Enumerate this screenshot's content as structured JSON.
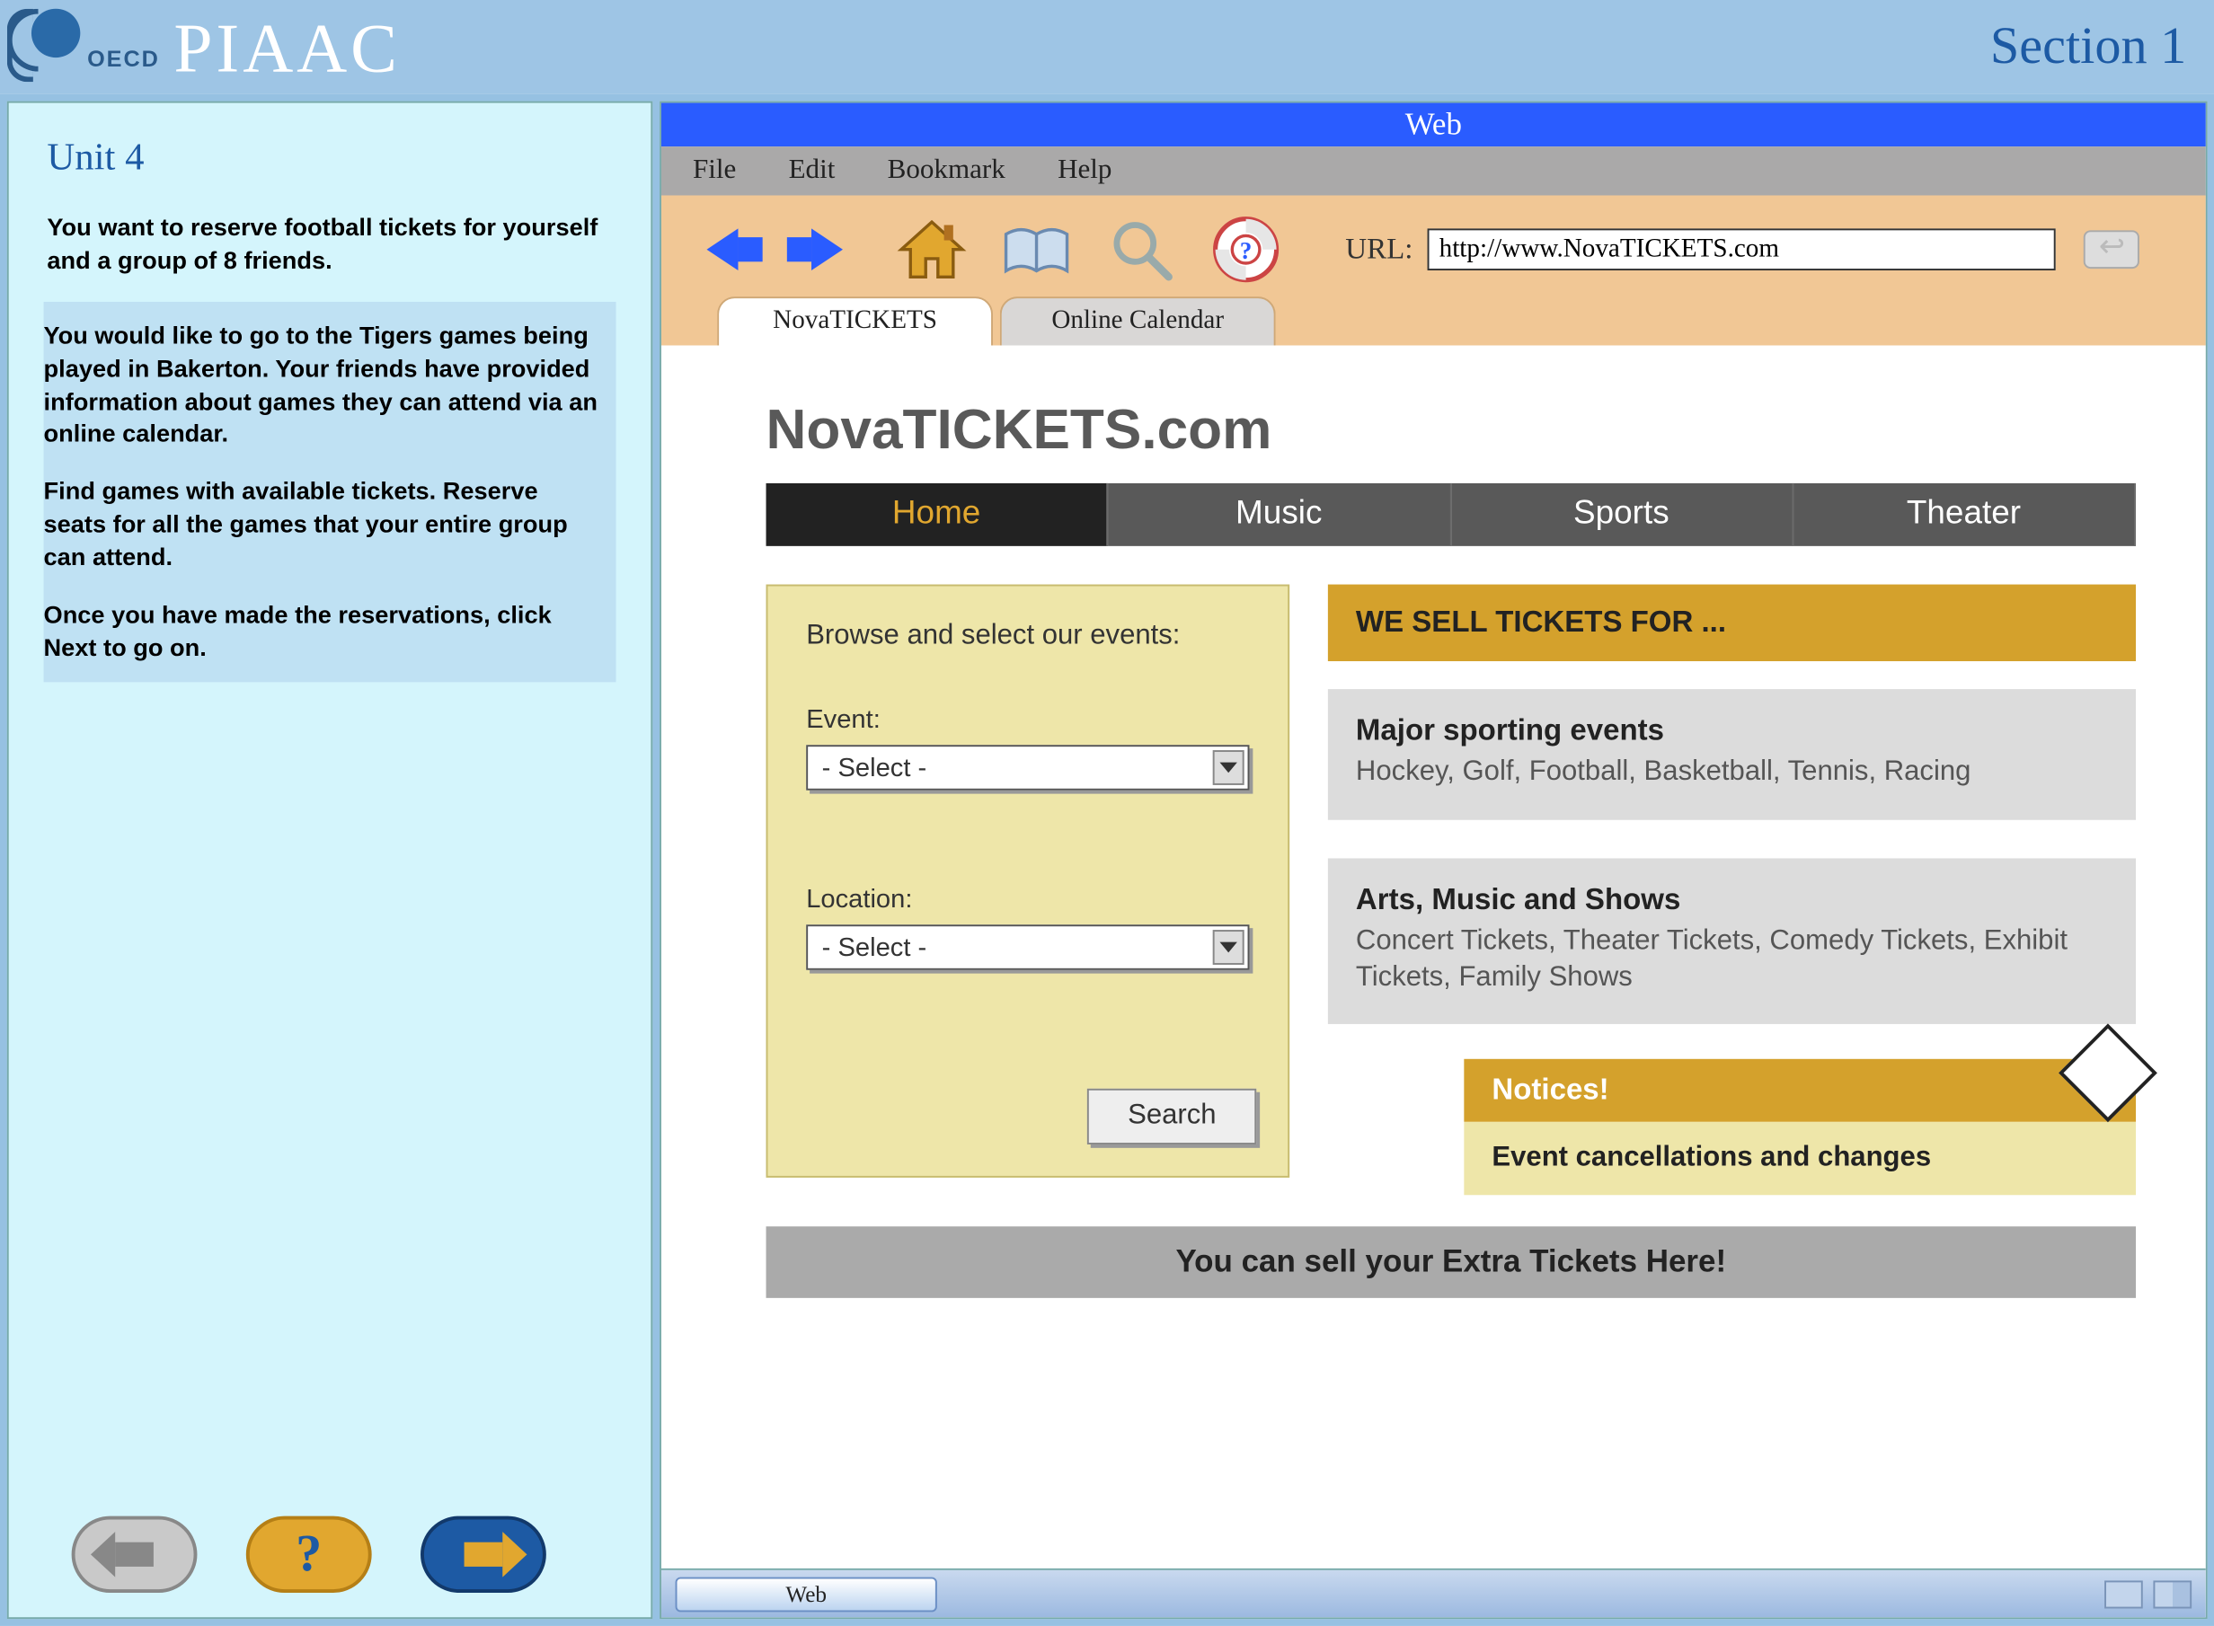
{
  "header": {
    "oecd": "OECD",
    "piaac": "PIAAC",
    "section": "Section 1"
  },
  "left": {
    "unit": "Unit 4",
    "intro": "You want to reserve football tickets for yourself and a group of 8 friends.",
    "p1": "You would like to go to the Tigers games being played in Bakerton. Your friends have provided information about games they can attend via an online calendar.",
    "p2": "Find games with available tickets. Reserve seats for all the games that your entire group can attend.",
    "p3": "Once you have made the reservations, click Next to go on."
  },
  "browser": {
    "title": "Web",
    "menu": [
      "File",
      "Edit",
      "Bookmark",
      "Help"
    ],
    "url_label": "URL:",
    "url_value": "http://www.NovaTICKETS.com",
    "tabs": [
      {
        "label": "NovaTICKETS",
        "active": true
      },
      {
        "label": "Online Calendar",
        "active": false
      }
    ]
  },
  "site": {
    "title": "NovaTICKETS.com",
    "nav": [
      "Home",
      "Music",
      "Sports",
      "Theater"
    ],
    "nav_active": "Home",
    "browse": {
      "heading": "Browse and select our events:",
      "event_label": "Event:",
      "event_value": "- Select -",
      "location_label": "Location:",
      "location_value": "- Select -",
      "search": "Search"
    },
    "sell_header": "WE SELL TICKETS FOR ...",
    "box1": {
      "title": "Major sporting events",
      "text": "Hockey, Golf, Football, Basketball, Tennis, Racing"
    },
    "box2": {
      "title": "Arts, Music and Shows",
      "text": "Concert Tickets, Theater Tickets, Comedy Tickets, Exhibit Tickets, Family Shows"
    },
    "notices": {
      "title": "Notices!",
      "sub": "Event cancellations and changes",
      "bang": "!"
    },
    "extra": "You can sell your Extra Tickets Here!"
  },
  "taskbar": {
    "web": "Web"
  }
}
